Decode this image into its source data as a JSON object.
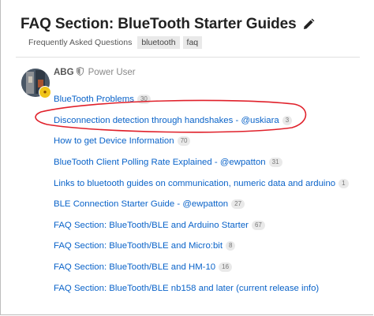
{
  "topic": {
    "title": "FAQ Section: BlueTooth Starter Guides",
    "category": "Frequently Asked Questions",
    "tags": [
      "bluetooth",
      "faq"
    ]
  },
  "post": {
    "username": "ABG",
    "user_title": "Power User",
    "links": [
      {
        "label": "BlueTooth Problems",
        "count": "30"
      },
      {
        "label": "Disconnection detection through handshakes - @uskiara",
        "count": "3"
      },
      {
        "label": "How to get Device Information",
        "count": "70"
      },
      {
        "label": "BlueTooth Client Polling Rate Explained - @ewpatton",
        "count": "31"
      },
      {
        "label": "Links to bluetooth guides on communication, numeric data and arduino",
        "count": "1"
      },
      {
        "label": "BLE Connection Starter Guide - @ewpatton",
        "count": "27"
      },
      {
        "label": "FAQ Section: BlueTooth/BLE and Arduino Starter",
        "count": "67"
      },
      {
        "label": "FAQ Section: BlueTooth/BLE and Micro:bit",
        "count": "8"
      },
      {
        "label": "FAQ Section: BlueTooth/BLE and HM-10",
        "count": "16"
      },
      {
        "label": "FAQ Section: BlueTooth/BLE nb158 and later (current release info)",
        "count": ""
      }
    ]
  },
  "colors": {
    "link": "#0a63c9",
    "annotation": "#e0202a",
    "badge": "#f0c419"
  },
  "icons": {
    "edit": "pencil-icon",
    "moderator": "shield-icon"
  }
}
